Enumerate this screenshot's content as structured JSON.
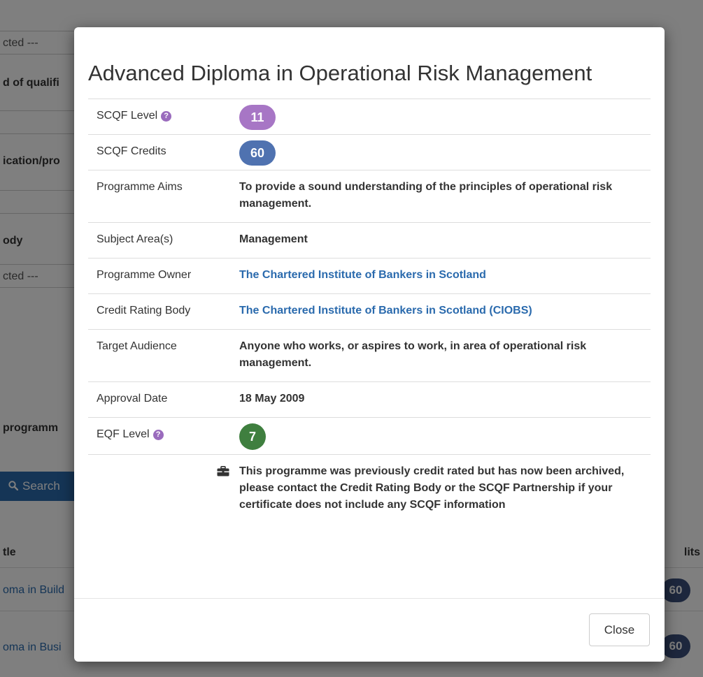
{
  "background": {
    "field_1_value": "cted ---",
    "label_1": "d of qualifi",
    "label_2": "ication/pro",
    "label_3": "ody",
    "field_2_value": "cted ---",
    "label_4": "programm",
    "search_button": "Search",
    "table_header_title": "tle",
    "table_header_credits": "lits",
    "rows": [
      {
        "title": "oma in Build",
        "credits": "60"
      },
      {
        "title": "oma in Busi",
        "credits": "60"
      }
    ]
  },
  "modal": {
    "title": "Advanced Diploma in Operational Risk Management",
    "rows": {
      "scqf_level": {
        "label": "SCQF Level",
        "value": "11"
      },
      "scqf_credits": {
        "label": "SCQF Credits",
        "value": "60"
      },
      "aims": {
        "label": "Programme Aims",
        "value": "To provide a sound understanding of the principles of operational risk management."
      },
      "subject": {
        "label": "Subject Area(s)",
        "value": "Management"
      },
      "owner": {
        "label": "Programme Owner",
        "value": "The Chartered Institute of Bankers in Scotland"
      },
      "rating_body": {
        "label": "Credit Rating Body",
        "value": "The Chartered Institute of Bankers in Scotland (CIOBS)"
      },
      "audience": {
        "label": "Target Audience",
        "value": "Anyone who works, or aspires to work, in area of operational risk management."
      },
      "approval": {
        "label": "Approval Date",
        "value": "18 May 2009"
      },
      "eqf_level": {
        "label": "EQF Level",
        "value": "7"
      }
    },
    "archive_note": "This programme was previously credit rated but has now been archived, please contact the Credit Rating Body or the SCQF Partnership if your certificate does not include any SCQF information",
    "help_glyph": "?",
    "close_label": "Close"
  },
  "icons": {
    "help": "question-circle-icon",
    "archive": "briefcase-icon",
    "search": "search-icon"
  },
  "colors": {
    "scqf_level_badge": "#a776c5",
    "credits_badge": "#4f72b0",
    "eqf_badge": "#3f7f3f",
    "link": "#2a6aad",
    "overlay": "rgba(0,0,0,0.5)"
  }
}
